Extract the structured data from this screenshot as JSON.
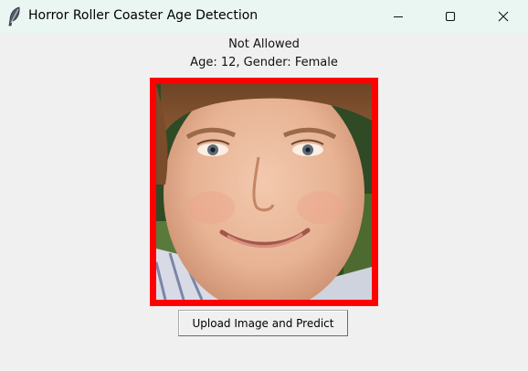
{
  "window": {
    "title": "Horror Roller Coaster Age Detection",
    "app_icon": "feather-icon",
    "controls": [
      "minimize-icon",
      "maximize-icon",
      "close-icon"
    ]
  },
  "result": {
    "status": "Not Allowed",
    "details": "Age: 12, Gender: Female",
    "frame_color": "#ff0000"
  },
  "photo": {
    "subject": "face-photo"
  },
  "actions": {
    "upload_label": "Upload Image and Predict"
  }
}
